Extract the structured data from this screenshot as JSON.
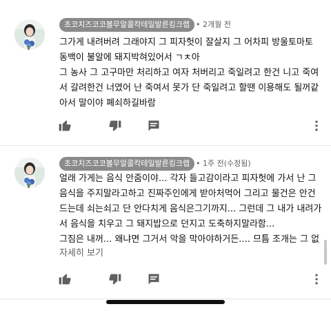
{
  "comments": [
    {
      "author": "초코치즈코코볼무알콜칵테일발른킹크랩",
      "time": "2개월 전",
      "lines": [
        "그가게 내려버려 그래야지 그 피자헛이 잘살지 그 어차피 방울토마토",
        "동백이 불알에 돼지박혀있어서 ㄱㅊ아",
        "그 농사 그 고구마만 처리하고 여자 처버리고 죽일려고 한건 니고 죽여",
        "서 갈려한건 너였어 난 죽여서 못가 단 죽일려고 할땐 이용해도 될꺼같",
        "아서 말이야 폐쇠하길바람"
      ],
      "more_label": ""
    },
    {
      "author": "초코치즈코코볼무알콜칵테일발른킹크랩",
      "time": "1주 전(수정됨)",
      "lines": [
        "얼래 가게는 음식 안줌이야... 각자 들고감이라고 피자헛에 가서 난 그",
        "음식을 주지말라고하고 진짜주인에게 받아처먹어 그리고 물건은 안건",
        "드는데 쇠는쇠고 단 안다치게 음식은그기까지... 그런데 그 내가 내려가",
        "서 음식을 치우고 그 돼지밥으로 던지고 도축하지말라함...",
        "그짐은 내꺼... 왜냐면 그거서 악을 막아야하거든.... 므틈 조개는 그 없"
      ],
      "more_label": "자세히 보기"
    }
  ],
  "icons": {
    "like": "thumb-up-icon",
    "dislike": "thumb-down-icon",
    "reply": "reply-icon",
    "menu": "more-vert-icon"
  },
  "colors": {
    "pill_bg": "#8a8a8a",
    "meta_text": "#606060",
    "icon": "#606060"
  }
}
